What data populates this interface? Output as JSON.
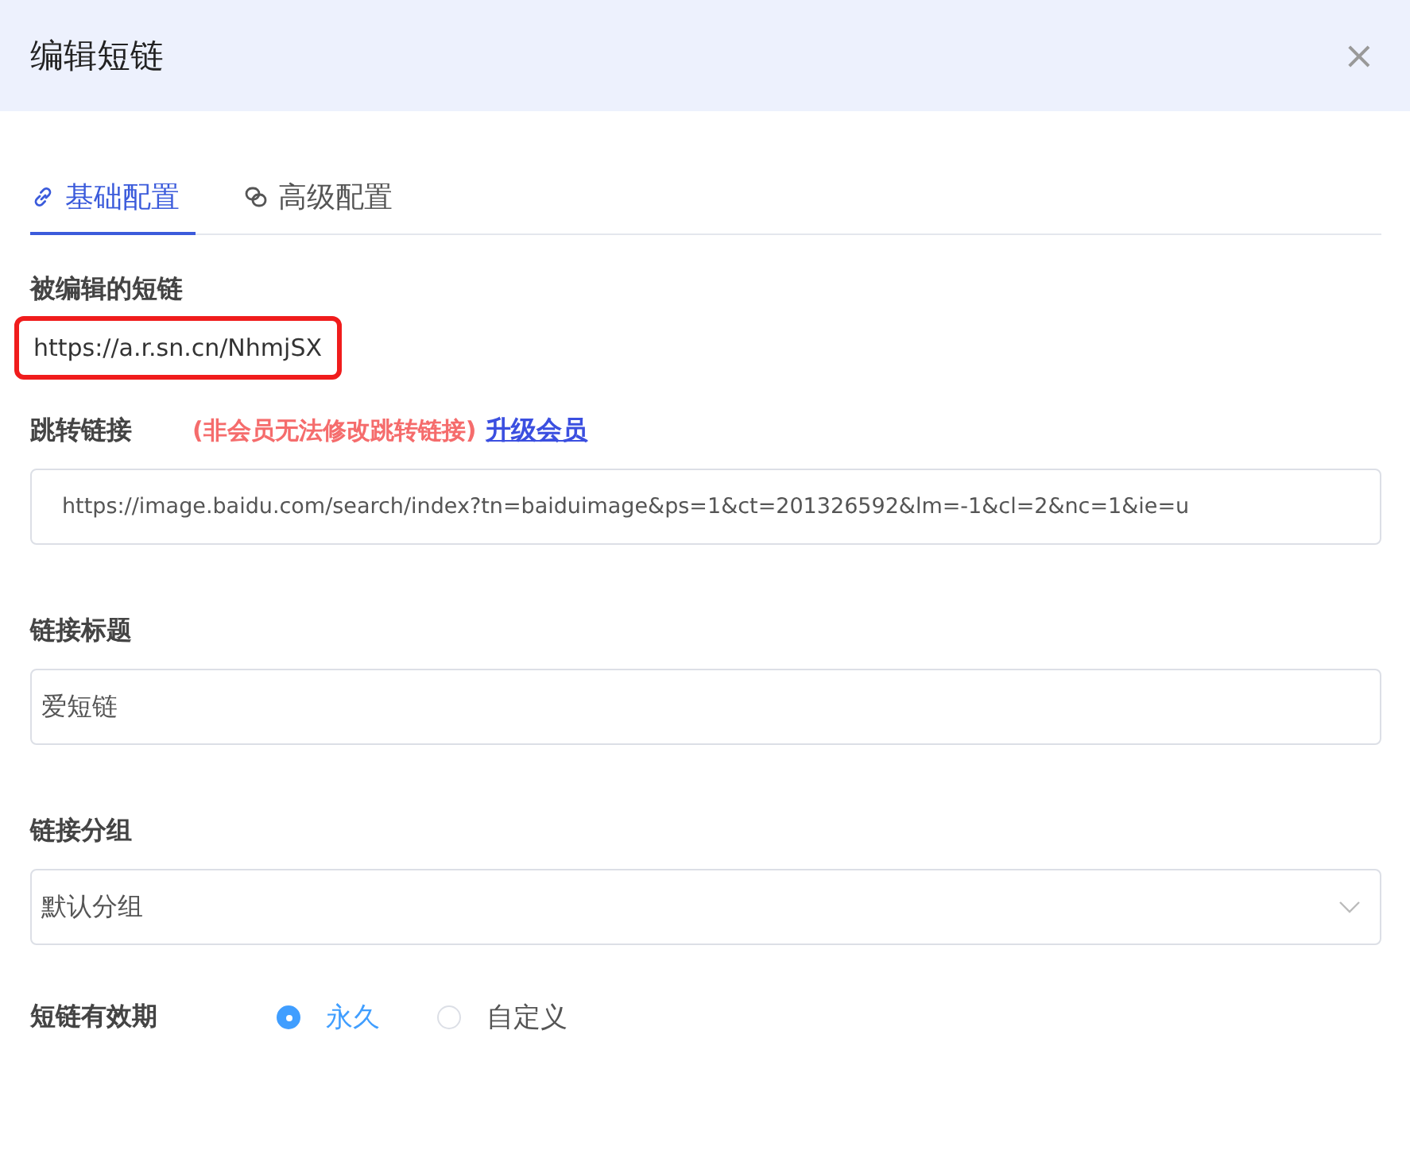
{
  "dialog": {
    "title": "编辑短链",
    "close": "×"
  },
  "tabs": [
    {
      "label": "基础配置",
      "kind": "link",
      "selected": true
    },
    {
      "label": "高级配置",
      "kind": "rings",
      "selected": false
    }
  ],
  "short_link": {
    "label": "被编辑的短链",
    "value": "https://a.r.sn.cn/NhmjSX",
    "highlighted": true
  },
  "redirect": {
    "label": "跳转链接",
    "notice": "(非会员无法修改跳转链接)",
    "upgrade_link": "升级会员",
    "value": "https://image.baidu.com/search/index?tn=baiduimage&ps=1&ct=201326592&lm=-1&cl=2&nc=1&ie=u"
  },
  "link_title": {
    "label": "链接标题",
    "value": "爱短链"
  },
  "link_group": {
    "label": "链接分组",
    "value": "默认分组"
  },
  "validity": {
    "label": "短链有效期",
    "options": [
      {
        "label": "永久",
        "selected": true
      },
      {
        "label": "自定义",
        "selected": false
      }
    ]
  }
}
